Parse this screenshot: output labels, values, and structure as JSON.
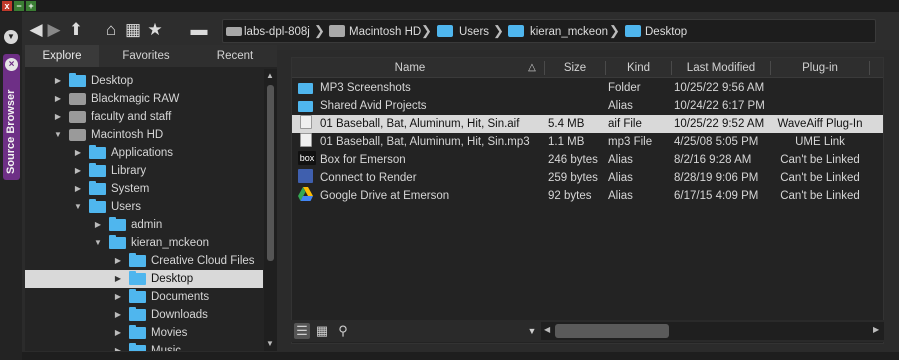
{
  "window": {
    "controls": [
      "x",
      "−",
      "+"
    ],
    "control_colors": [
      "#c0392b",
      "#3a7d33",
      "#3a7d33"
    ]
  },
  "side_tab": {
    "label": "Source Browser",
    "close_glyph": "×",
    "color": "#6e2f86"
  },
  "toolbar": {
    "icons": [
      "back-icon",
      "forward-icon",
      "up-icon",
      "home-icon",
      "star-icon",
      "drive-icon"
    ],
    "breadcrumb": [
      {
        "label": "labs-dpl-808j",
        "icon": "computer-icon"
      },
      {
        "label": "Macintosh HD",
        "icon": "disk-icon"
      },
      {
        "label": "Users",
        "icon": "folder-icon"
      },
      {
        "label": "kieran_mckeon",
        "icon": "home-folder-icon"
      },
      {
        "label": "Desktop",
        "icon": "desktop-folder-icon"
      }
    ],
    "separator": "❯"
  },
  "left_panel": {
    "tabs": [
      "Explore",
      "Favorites",
      "Recent"
    ],
    "active_tab": "Explore",
    "tree": [
      {
        "label": "Desktop",
        "level": 0,
        "expanded": false,
        "icon": "folder"
      },
      {
        "label": "Blackmagic RAW",
        "level": 0,
        "expanded": false,
        "icon": "drive"
      },
      {
        "label": "faculty and staff",
        "level": 0,
        "expanded": false,
        "icon": "drive"
      },
      {
        "label": "Macintosh HD",
        "level": 0,
        "expanded": true,
        "icon": "drive"
      },
      {
        "label": "Applications",
        "level": 1,
        "expanded": false,
        "icon": "folder"
      },
      {
        "label": "Library",
        "level": 1,
        "expanded": false,
        "icon": "folder"
      },
      {
        "label": "System",
        "level": 1,
        "expanded": false,
        "icon": "folder"
      },
      {
        "label": "Users",
        "level": 1,
        "expanded": true,
        "icon": "folder"
      },
      {
        "label": "admin",
        "level": 2,
        "expanded": false,
        "icon": "folder"
      },
      {
        "label": "kieran_mckeon",
        "level": 2,
        "expanded": true,
        "icon": "folder"
      },
      {
        "label": "Creative Cloud Files",
        "level": 3,
        "expanded": false,
        "icon": "folder"
      },
      {
        "label": "Desktop",
        "level": 3,
        "expanded": false,
        "icon": "folder",
        "selected": true
      },
      {
        "label": "Documents",
        "level": 3,
        "expanded": false,
        "icon": "folder"
      },
      {
        "label": "Downloads",
        "level": 3,
        "expanded": false,
        "icon": "folder"
      },
      {
        "label": "Movies",
        "level": 3,
        "expanded": false,
        "icon": "folder"
      },
      {
        "label": "Music",
        "level": 3,
        "expanded": false,
        "icon": "folder"
      }
    ]
  },
  "file_list": {
    "columns": [
      "Name",
      "Size",
      "Kind",
      "Last Modified",
      "Plug-in"
    ],
    "sort_indicator": "△",
    "rows": [
      {
        "name": "MP3 Screenshots",
        "size": "",
        "kind": "Folder",
        "modified": "10/25/22 9:56 AM",
        "plugin": "",
        "icon": "folder",
        "icon_color": "#4fb6ee"
      },
      {
        "name": "Shared Avid Projects",
        "size": "",
        "kind": "Alias",
        "modified": "10/24/22 6:17 PM",
        "plugin": "",
        "icon": "folder",
        "icon_color": "#4fb6ee"
      },
      {
        "name": "01 Baseball, Bat, Aluminum, Hit, Sin.aif",
        "size": "5.4 MB",
        "kind": "aif File",
        "modified": "10/25/22 9:52 AM",
        "plugin": "WaveAiff Plug-In",
        "icon": "audio-file",
        "icon_color": "#f0f0f0",
        "selected": true
      },
      {
        "name": "01 Baseball, Bat, Aluminum, Hit, Sin.mp3",
        "size": "1.1 MB",
        "kind": "mp3 File",
        "modified": "4/25/08 5:05 PM",
        "plugin": "UME Link",
        "icon": "audio-file",
        "icon_color": "#f0f0f0"
      },
      {
        "name": "Box for Emerson",
        "size": "246 bytes",
        "kind": "Alias",
        "modified": "8/2/16 9:28 AM",
        "plugin": "Can't be Linked",
        "icon": "box-logo",
        "icon_color": "#111111"
      },
      {
        "name": "Connect to Render",
        "size": "259 bytes",
        "kind": "Alias",
        "modified": "8/28/19 9:06 PM",
        "plugin": "Can't be Linked",
        "icon": "render-folder",
        "icon_color": "#3f5fae"
      },
      {
        "name": "Google Drive at Emerson",
        "size": "92 bytes",
        "kind": "Alias",
        "modified": "6/17/15 4:09 PM",
        "plugin": "Can't be Linked",
        "icon": "google-drive",
        "icon_color": "#34a853"
      }
    ],
    "box_logo_text": "box"
  },
  "bottom_bar": {
    "icons": [
      "list-view-icon",
      "grid-view-icon",
      "search-icon"
    ],
    "dropdown_glyph": "▼"
  }
}
